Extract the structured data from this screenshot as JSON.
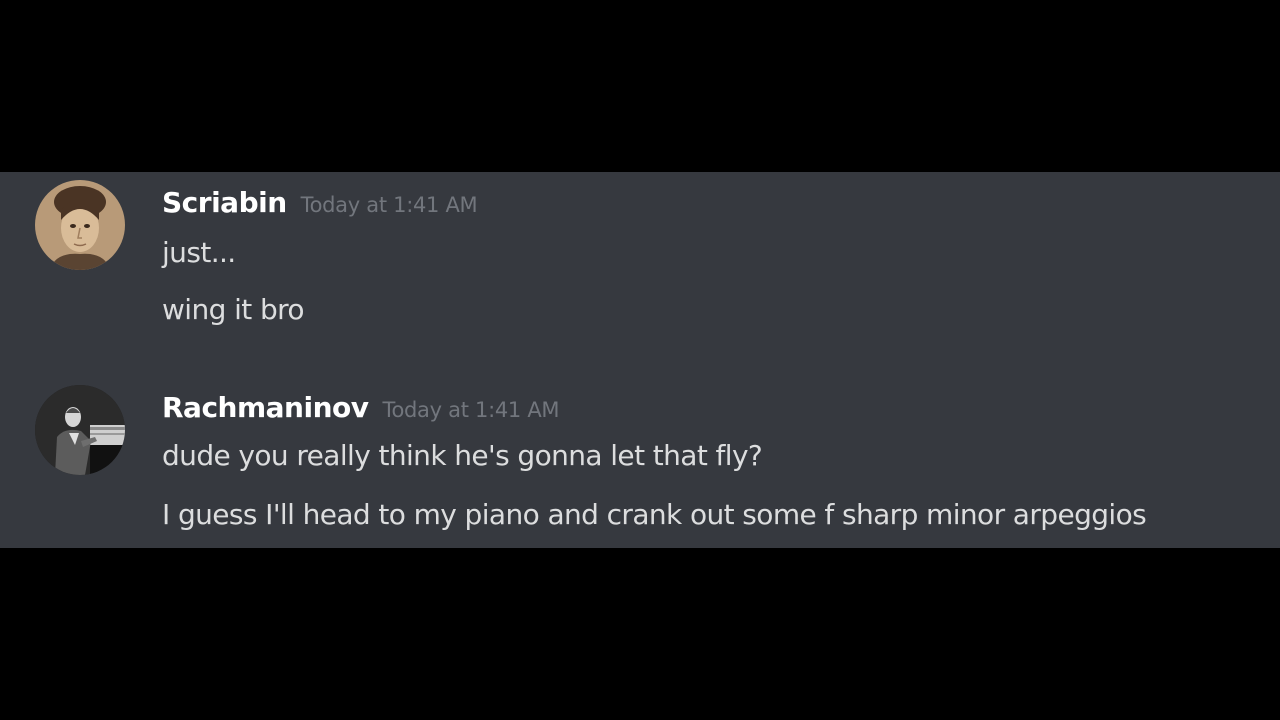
{
  "messages": [
    {
      "username": "Scriabin",
      "timestamp": "Today at 1:41 AM",
      "avatar_icon": "scriabin-avatar",
      "lines": [
        "just...",
        "wing it bro"
      ]
    },
    {
      "username": "Rachmaninov",
      "timestamp": "Today at 1:41 AM",
      "avatar_icon": "rachmaninov-avatar",
      "lines": [
        "dude you really think he's gonna let that fly?",
        "I guess I'll head to my piano and crank out some f sharp minor arpeggios"
      ]
    }
  ],
  "colors": {
    "background": "#36393f",
    "letterbox": "#000000",
    "username": "#ffffff",
    "message_text": "#dcddde",
    "timestamp": "#72767d"
  }
}
